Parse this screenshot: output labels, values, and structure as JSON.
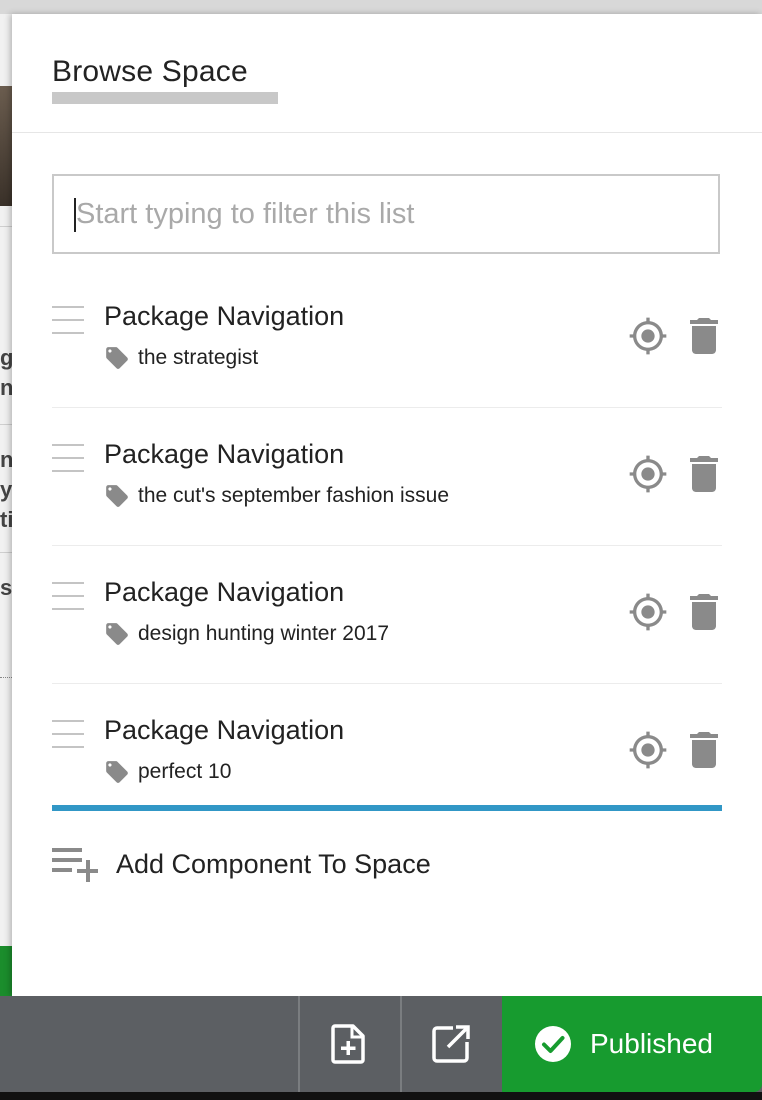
{
  "panel": {
    "title": "Browse Space"
  },
  "filter": {
    "placeholder": "Start typing to filter this list",
    "value": ""
  },
  "items": [
    {
      "name": "Package Navigation",
      "tag": "the strategist"
    },
    {
      "name": "Package Navigation",
      "tag": "the cut's september fashion issue"
    },
    {
      "name": "Package Navigation",
      "tag": "design hunting winter 2017"
    },
    {
      "name": "Package Navigation",
      "tag": "perfect 10"
    }
  ],
  "add_component": {
    "label": "Add Component To Space"
  },
  "toolbar": {
    "new_page_icon": "new-page-icon",
    "preview_icon": "open-external-icon",
    "publish_label": "Published"
  },
  "colors": {
    "accent_divider": "#3197c6",
    "published_green": "#179b2f",
    "toolbar_gray": "#5c5f63",
    "icon_gray": "#8a8a8a"
  }
}
